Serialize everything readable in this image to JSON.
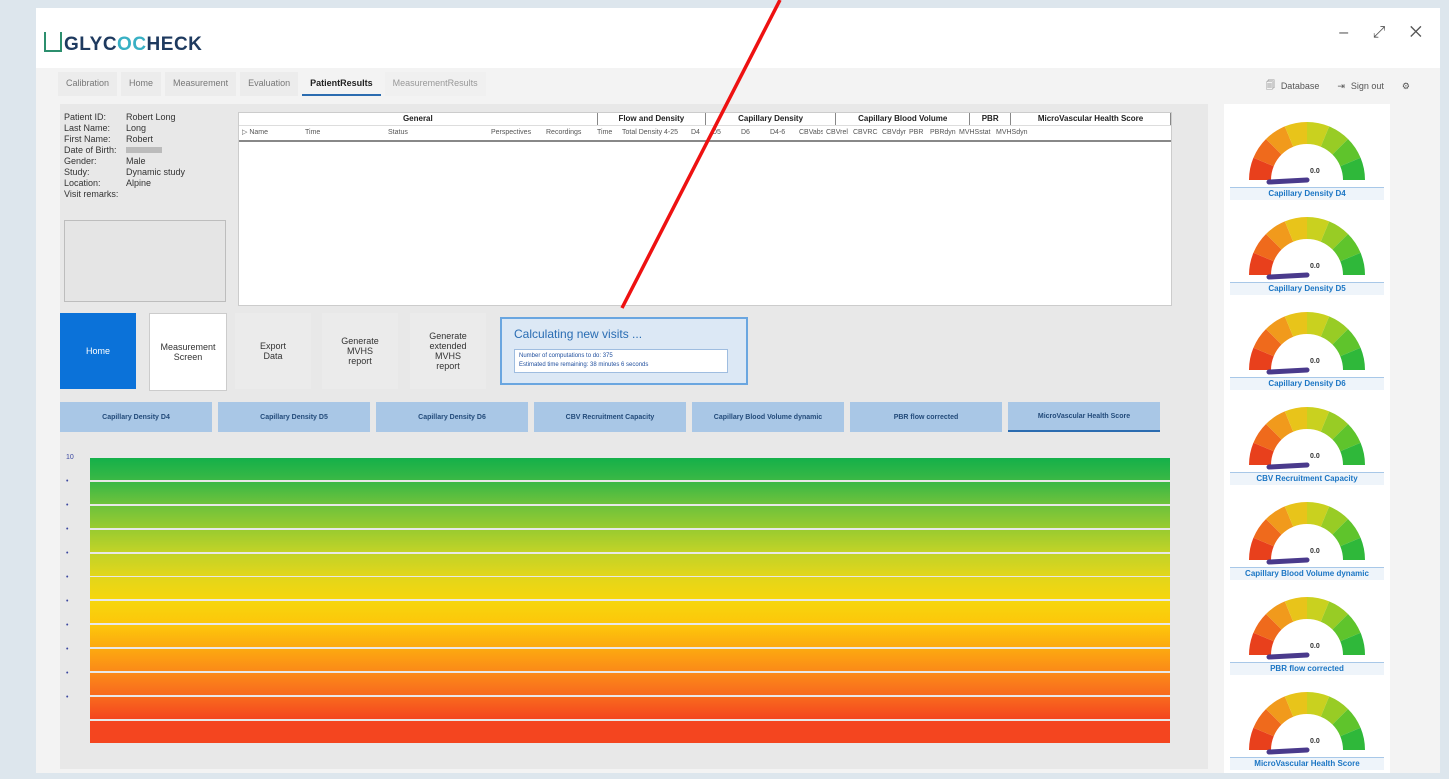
{
  "app": {
    "logo_prefix": "GLYC",
    "logo_oo": "OC",
    "logo_suffix": "HECK",
    "window_controls": "– ⤢ ✕"
  },
  "tabs": [
    "Calibration",
    "Home",
    "Measurement",
    "Evaluation",
    "PatientResults",
    "MeasurementResults"
  ],
  "active_tab": 4,
  "topright": {
    "database": "Database",
    "signout": "Sign out"
  },
  "patient": [
    {
      "k": "Patient ID:",
      "v": "Robert Long"
    },
    {
      "k": "Last Name:",
      "v": "Long"
    },
    {
      "k": "First Name:",
      "v": "Robert"
    },
    {
      "k": "Date of Birth:",
      "v": ""
    },
    {
      "k": "Gender:",
      "v": "Male"
    },
    {
      "k": "Study:",
      "v": "Dynamic study"
    },
    {
      "k": "Location:",
      "v": "Alpine"
    },
    {
      "k": "Visit remarks:",
      "v": ""
    }
  ],
  "table": {
    "groups": [
      {
        "label": "General",
        "w": 360
      },
      {
        "label": "Flow and Density",
        "w": 108
      },
      {
        "label": "Capillary Density",
        "w": 130
      },
      {
        "label": "Capillary Blood Volume",
        "w": 134
      },
      {
        "label": "PBR",
        "w": 40
      },
      {
        "label": "MicroVascular Health Score",
        "w": 160
      }
    ],
    "columns": [
      "▷ Name",
      "Time",
      "Status",
      "Perspectives",
      "Recordings",
      "Time",
      "Total Density 4-25",
      "D4",
      "D5",
      "D6",
      "D4-6",
      "CBVabs",
      "CBVrel",
      "CBVRC",
      "CBVdyn",
      "PBR",
      "PBRdyn",
      "MVHSstat",
      "MVHSdyn"
    ]
  },
  "buttons": [
    "Home",
    "Measurement\nScreen",
    "Export\nData",
    "Generate\nMVHS\nreport",
    "Generate\nextended\nMVHS\nreport"
  ],
  "calc": {
    "title": "Calculating new visits ...",
    "line1": "Number of computations to do:  375",
    "line2": "Estimated time remaining:  38 minutes 6 seconds"
  },
  "filter_tabs": [
    "Capillary Density D4",
    "Capillary Density D5",
    "Capillary Density D6",
    "CBV Recruitment Capacity",
    "Capillary Blood Volume dynamic",
    "PBR flow corrected",
    "MicroVascular Health Score"
  ],
  "chart_data": {
    "type": "heatmap",
    "y_ticks": [
      "10",
      "9",
      "8",
      "7",
      "6",
      "5",
      "4",
      "3",
      "2",
      "1",
      "0"
    ],
    "band_colors": [
      "#14b04a",
      "#3ab845",
      "#6ec23c",
      "#9acb30",
      "#c2d327",
      "#e2d61b",
      "#f6d60d",
      "#fdc70a",
      "#fca910",
      "#fb8a18",
      "#f86a1e",
      "#f4451f"
    ]
  },
  "gauges": [
    {
      "label": "Capillary Density D4",
      "value": "0.0"
    },
    {
      "label": "Capillary Density D5",
      "value": "0.0"
    },
    {
      "label": "Capillary Density D6",
      "value": "0.0"
    },
    {
      "label": "CBV Recruitment Capacity",
      "value": "0.0"
    },
    {
      "label": "Capillary Blood Volume dynamic",
      "value": "0.0"
    },
    {
      "label": "PBR flow corrected",
      "value": "0.0"
    },
    {
      "label": "MicroVascular Health Score",
      "value": "0.0"
    }
  ]
}
